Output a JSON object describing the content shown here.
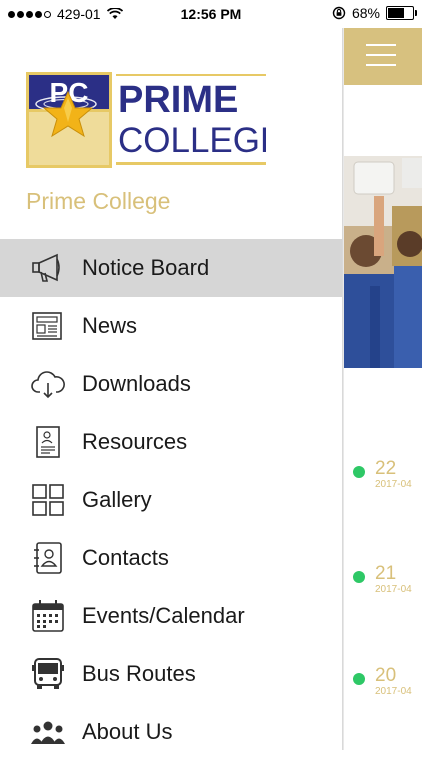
{
  "status_bar": {
    "carrier": "429-01",
    "time": "12:56 PM",
    "battery": "68%",
    "battery_level": 0.68
  },
  "drawer": {
    "logo": {
      "line1": "PRIME",
      "line2": "COLLEGE",
      "monogram": "PC"
    },
    "title": "Prime College",
    "menu": [
      {
        "label": "Notice Board",
        "icon": "megaphone-icon",
        "active": true
      },
      {
        "label": "News",
        "icon": "newspaper-icon"
      },
      {
        "label": "Downloads",
        "icon": "cloud-download-icon"
      },
      {
        "label": "Resources",
        "icon": "document-icon"
      },
      {
        "label": "Gallery",
        "icon": "grid-icon"
      },
      {
        "label": "Contacts",
        "icon": "contact-book-icon"
      },
      {
        "label": "Events/Calendar",
        "icon": "calendar-icon"
      },
      {
        "label": "Bus Routes",
        "icon": "bus-icon"
      },
      {
        "label": "About Us",
        "icon": "group-icon"
      }
    ]
  },
  "background_content": {
    "notices": [
      {
        "day": "22",
        "date": "2017-04"
      },
      {
        "day": "21",
        "date": "2017-04"
      },
      {
        "day": "20",
        "date": "2017-04"
      }
    ]
  },
  "colors": {
    "accent_gold": "#d7c17f",
    "active_row": "#d6d6d6",
    "logo_navy": "#2b2f86",
    "dot_green": "#2ec866"
  }
}
